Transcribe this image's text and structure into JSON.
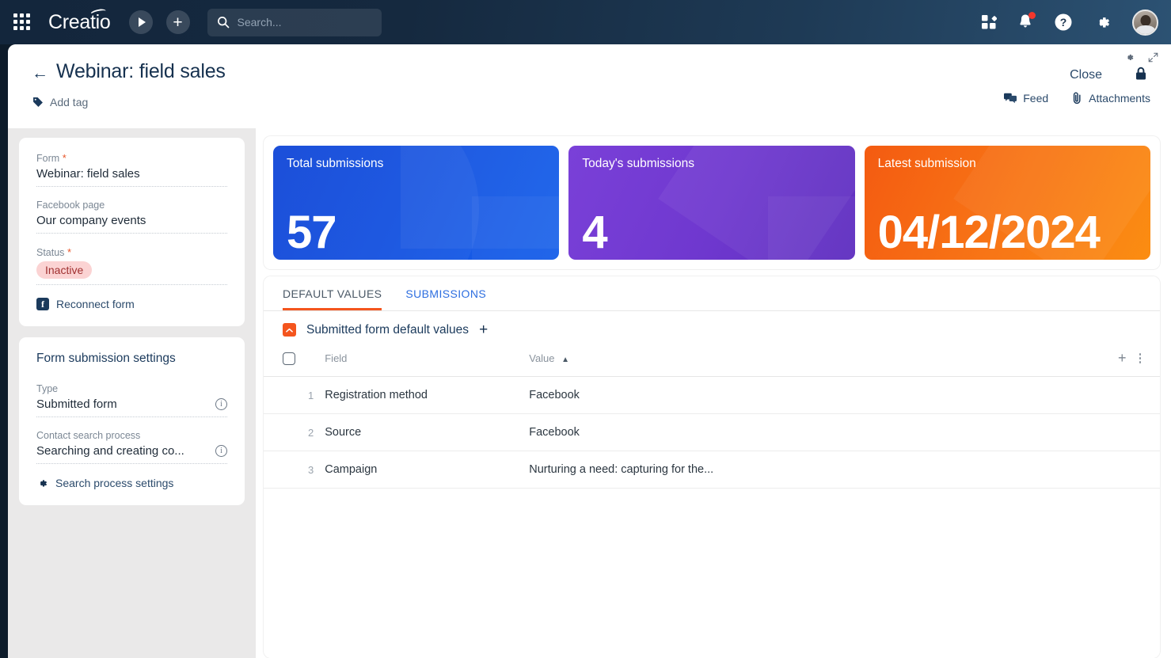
{
  "topnav": {
    "brand": "Creatio",
    "search_placeholder": "Search...",
    "search_value": "",
    "apps_icon": "apps-grid-icon",
    "play_icon": "play-icon",
    "add_icon": "plus-icon",
    "marketplace_icon": "marketplace-icon",
    "notifications_icon": "bell-icon",
    "help_icon": "help-icon",
    "settings_icon": "gear-icon",
    "avatar_icon": "user-avatar"
  },
  "header": {
    "back_icon": "back-arrow-icon",
    "title": "Webinar: field sales",
    "add_tag": "Add tag",
    "tag_icon": "tag-icon",
    "close_label": "Close",
    "lock_icon": "lock-icon",
    "gear_icon": "gear-icon",
    "expand_icon": "expand-icon",
    "feed_label": "Feed",
    "feed_icon": "feed-icon",
    "attachments_label": "Attachments",
    "attachments_icon": "paperclip-icon"
  },
  "sidebar": {
    "form_card": {
      "fields": [
        {
          "label": "Form",
          "required": true,
          "value": "Webinar: field sales"
        },
        {
          "label": "Facebook page",
          "required": false,
          "value": "Our company events"
        },
        {
          "label": "Status",
          "required": true,
          "value": "Inactive"
        }
      ],
      "reconnect_label": "Reconnect form",
      "reconnect_icon": "facebook-icon"
    },
    "settings_card": {
      "title": "Form submission settings",
      "type_label": "Type",
      "type_value": "Submitted form",
      "process_label": "Contact search process",
      "process_value": "Searching and creating co...",
      "info_icon": "info-icon",
      "search_settings_label": "Search process settings",
      "search_settings_icon": "gear-icon"
    }
  },
  "metrics": [
    {
      "label": "Total submissions",
      "value": "57",
      "color": "#1452e0"
    },
    {
      "label": "Today's submissions",
      "value": "4",
      "color": "#6f38cf"
    },
    {
      "label": "Latest submission",
      "value": "04/12/2024",
      "color": "#f87716"
    }
  ],
  "tabs": [
    {
      "label": "DEFAULT VALUES",
      "active": true
    },
    {
      "label": "SUBMISSIONS",
      "active": false
    }
  ],
  "section": {
    "title": "Submitted form default values",
    "collapse_icon": "chevron-up-icon",
    "add_icon": "plus-icon"
  },
  "table": {
    "columns": {
      "field": "Field",
      "value": "Value"
    },
    "sort_column": "Value",
    "sort_direction": "asc",
    "add_icon": "plus-icon",
    "menu_icon": "more-vertical-icon",
    "rows": [
      {
        "num": "1",
        "field": "Registration method",
        "value": "Facebook"
      },
      {
        "num": "2",
        "field": "Source",
        "value": "Facebook"
      },
      {
        "num": "3",
        "field": "Campaign",
        "value": "Nurturing a need: capturing for the..."
      }
    ]
  }
}
